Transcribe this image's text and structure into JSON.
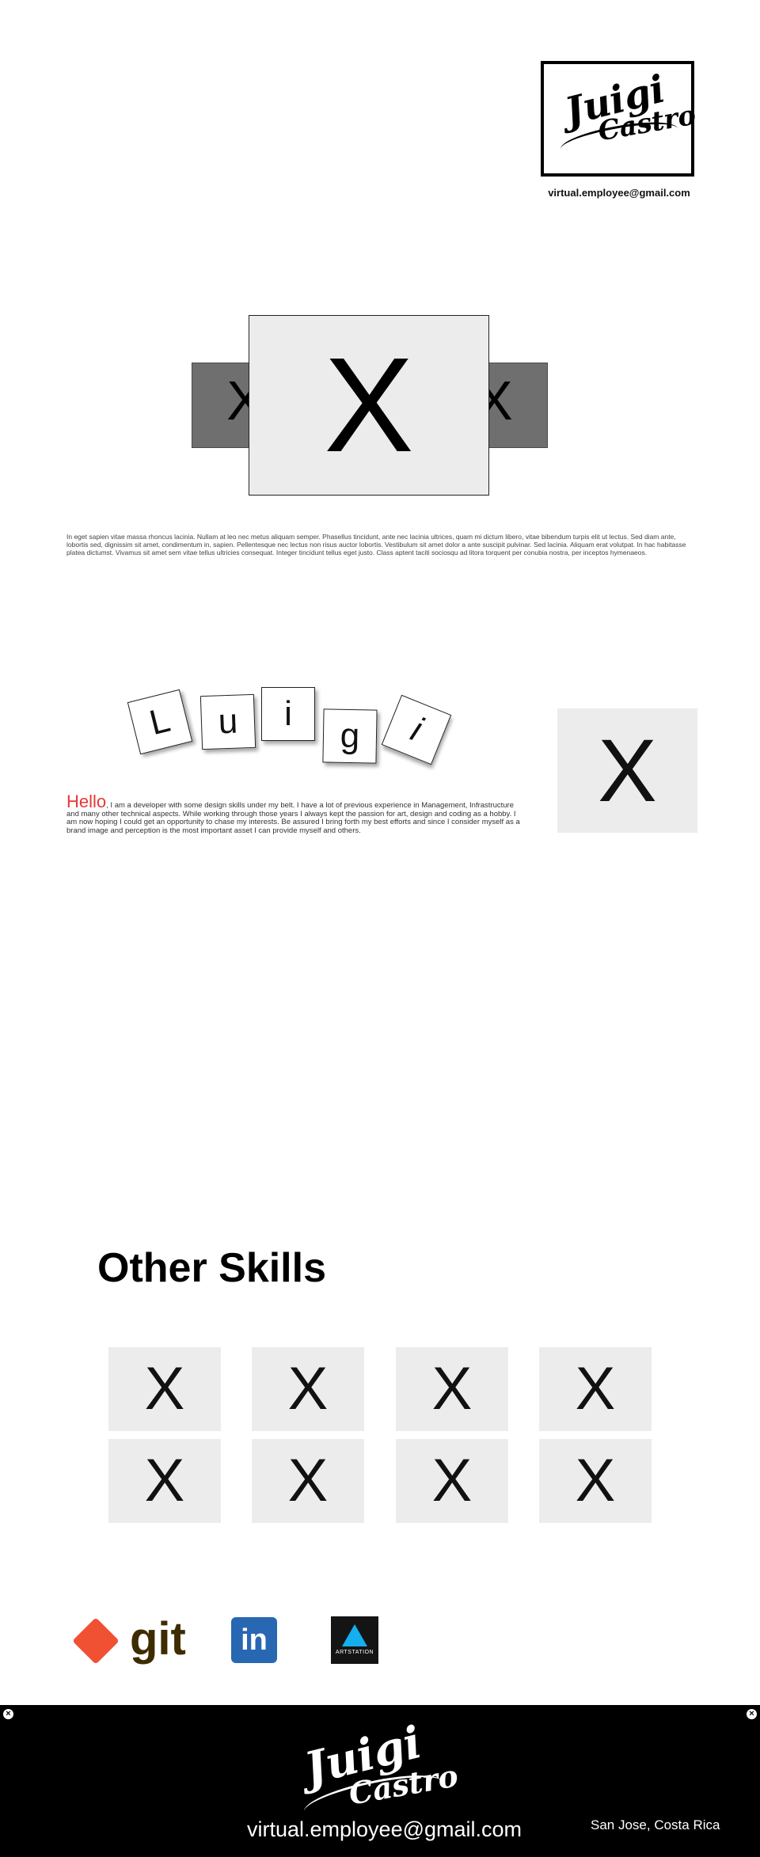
{
  "header": {
    "logo_line1": "Juigi",
    "logo_line2": "Castro",
    "email": "virtual.employee@gmail.com"
  },
  "carousel": {
    "main_placeholder": "X",
    "side_placeholder_left": "X",
    "side_placeholder_right": "X"
  },
  "intro_text": "In eget sapien vitae massa rhoncus lacinia. Nullam at leo nec metus aliquam semper. Phasellus tincidunt, ante nec lacinia ultrices, quam mi dictum libero, vitae bibendum turpis elit ut lectus. Sed diam ante, lobortis sed, dignissim sit amet, condimentum in, sapien. Pellentesque nec lectus non risus auctor lobortis. Vestibulum sit amet dolor a ante suscipit pulvinar. Sed lacinia. Aliquam erat volutpat. In hac habitasse platea dictumst. Vivamus sit amet sem vitae tellus ultricies consequat. Integer tincidunt tellus eget justo. Class aptent taciti sociosqu ad litora torquent per conubia nostra, per inceptos hymenaeos.",
  "name_tiles": [
    "L",
    "u",
    "i",
    "g",
    "i"
  ],
  "profile_placeholder": "X",
  "about": {
    "hello": "Hello",
    "text": ", I am a developer with some design skills under my belt. I have a lot of previous experience in Management, Infrastructure and many other technical aspects. While working through those years I always kept the passion for art, design and coding as a hobby. I am now hoping I could get an opportunity to chase my interests. Be assured I bring forth my best efforts and since I consider myself as a brand image and perception is the most important asset I can provide myself and others."
  },
  "skills": {
    "title": "Other Skills",
    "items": [
      "X",
      "X",
      "X",
      "X",
      "X",
      "X",
      "X",
      "X"
    ]
  },
  "social": {
    "git_label": "git",
    "linkedin_label": "in",
    "artstation_label": "ARTSTATION",
    "git_color": "#f05133",
    "linkedin_color": "#2867b2",
    "artstation_color": "#13aff0"
  },
  "footer": {
    "logo_line1": "Juigi",
    "logo_line2": "Castro",
    "email": "virtual.employee@gmail.com",
    "location": "San Jose, Costa Rica",
    "close_glyph": "×"
  }
}
